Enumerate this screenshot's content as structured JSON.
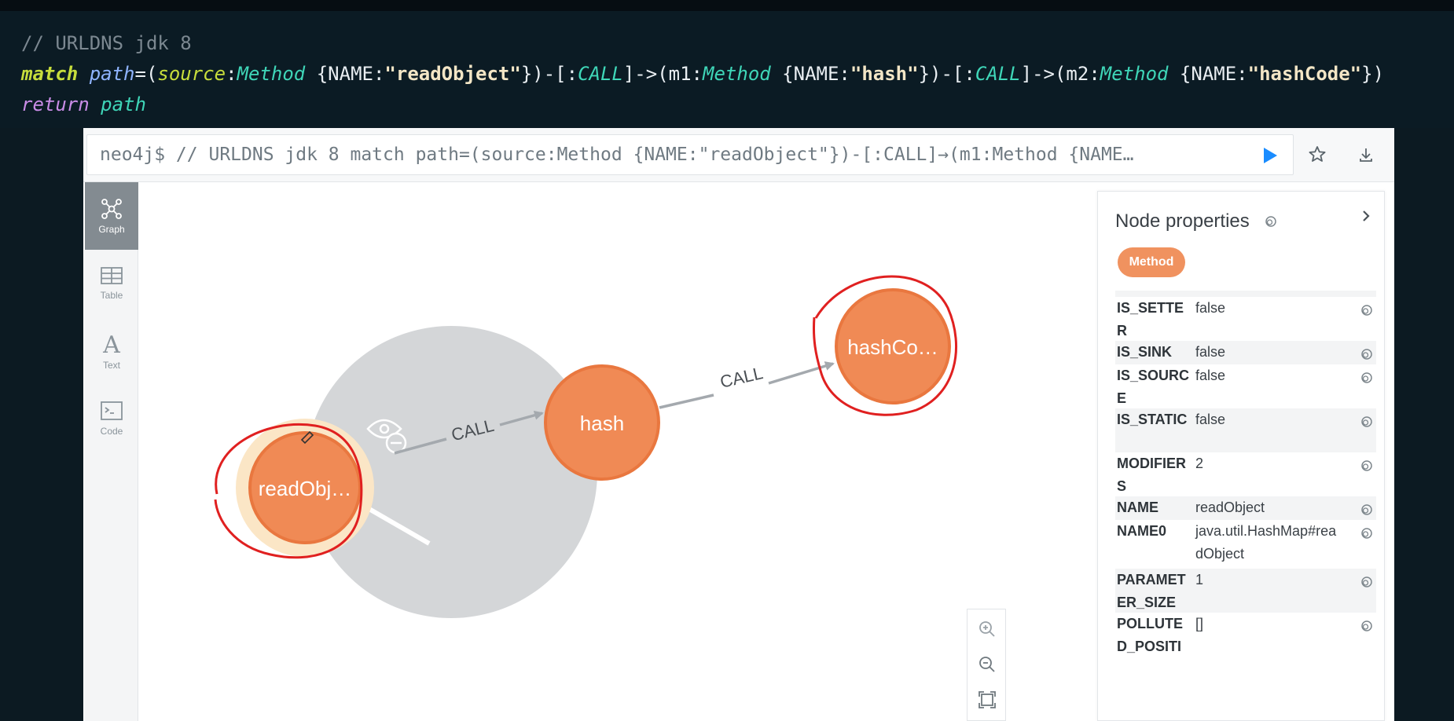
{
  "code_banner": {
    "comment": "// URLDNS jdk 8",
    "line2": {
      "kw_match": "match",
      "var_path": "path",
      "eq_paren": "=(",
      "var_source": "source",
      "colon1": ":",
      "label1": "Method",
      "prop1_open": " {NAME:",
      "str1": "\"readObject\"",
      "close1": "})-[:",
      "rel1": "CALL",
      "arrow1": "]->(m1:",
      "label2": "Method",
      "prop2_open": " {NAME:",
      "str2": "\"hash\"",
      "close2": "})-[:",
      "rel2": "CALL",
      "arrow2": "]->(m2:",
      "label3": "Method",
      "prop3_open": " {NAME:",
      "str3": "\"hashCode\"",
      "close3": "})"
    },
    "line3": {
      "kw_return": "return",
      "var_path": "path"
    }
  },
  "editor": {
    "text": "neo4j$ // URLDNS jdk 8 match path=(source:Method {NAME:\"readObject\"})-[:CALL]→(m1:Method {NAME…"
  },
  "sidebar": {
    "items": [
      {
        "label": "Graph",
        "icon": "graph-icon",
        "active": true
      },
      {
        "label": "Table",
        "icon": "table-icon",
        "active": false
      },
      {
        "label": "Text",
        "icon": "text-icon",
        "active": false
      },
      {
        "label": "Code",
        "icon": "code-icon",
        "active": false
      }
    ]
  },
  "graph": {
    "nodes": [
      {
        "label": "readObj…"
      },
      {
        "label": "hash"
      },
      {
        "label": "hashCo…"
      }
    ],
    "relationships": [
      {
        "label": "CALL"
      },
      {
        "label": "CALL"
      }
    ],
    "node_color": "#f08a55",
    "node_border": "#e9773f"
  },
  "properties": {
    "title": "Node properties",
    "badge": "Method",
    "rows": [
      {
        "key": "IS_SETTER",
        "value": "false"
      },
      {
        "key": "IS_SINK",
        "value": "false"
      },
      {
        "key": "IS_SOURCE",
        "value": "false"
      },
      {
        "key": "IS_STATIC",
        "value": "false"
      },
      {
        "key": "MODIFIERS",
        "value": "2"
      },
      {
        "key": "NAME",
        "value": "readObject"
      },
      {
        "key": "NAME0",
        "value": "java.util.HashMap#readObject"
      },
      {
        "key": "PARAMETER_SIZE",
        "value": "1"
      },
      {
        "key": "POLLUTED_POSITI",
        "value": "[]"
      }
    ]
  }
}
